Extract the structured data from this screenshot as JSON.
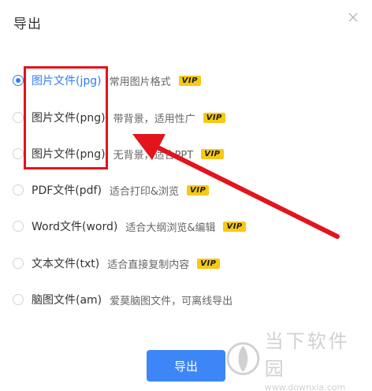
{
  "dialog": {
    "title": "导出",
    "close_icon": "close-icon"
  },
  "options": [
    {
      "name": "图片文件(jpg)",
      "desc": "常用图片格式",
      "vip": "VIP",
      "selected": true
    },
    {
      "name": "图片文件(png)",
      "desc": "带背景，适用性广",
      "vip": "VIP",
      "selected": false
    },
    {
      "name": "图片文件(png)",
      "desc": "无背景，适合PPT",
      "vip": "VIP",
      "selected": false
    },
    {
      "name": "PDF文件(pdf)",
      "desc": "适合打印&浏览",
      "vip": "VIP",
      "selected": false
    },
    {
      "name": "Word文件(word)",
      "desc": "适合大纲浏览&编辑",
      "vip": "VIP",
      "selected": false
    },
    {
      "name": "文本文件(txt)",
      "desc": "适合直接复制内容",
      "vip": "VIP",
      "selected": false
    },
    {
      "name": "脑图文件(am)",
      "desc": "爱莫脑图文件，可离线导出",
      "vip": "",
      "selected": false
    }
  ],
  "export_button": {
    "label": "导出"
  },
  "annotation": {
    "box_color": "#e3141b",
    "arrow_color": "#e3141b"
  },
  "watermark": {
    "title": "当下软件园",
    "url": "www.downxia.com"
  },
  "colors": {
    "accent": "#2f7df6",
    "button": "#3d86f7",
    "vip": "#f6c914"
  }
}
